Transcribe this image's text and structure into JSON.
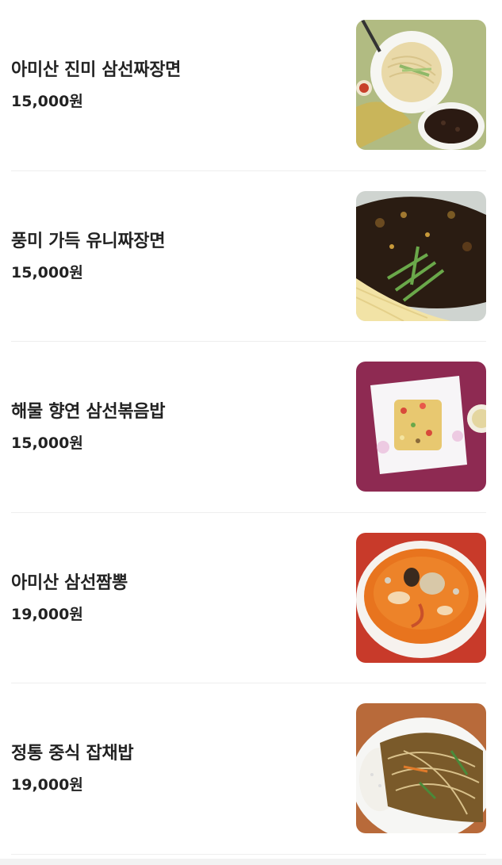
{
  "menu": {
    "items": [
      {
        "name": "아미산 진미 삼선짜장면",
        "price": "15,000원",
        "image": "jjajang-noodles-side-sauce-photo"
      },
      {
        "name": "풍미 가득 유니짜장면",
        "price": "15,000원",
        "image": "uni-jjajang-noodles-photo"
      },
      {
        "name": "해물 향연 삼선볶음밥",
        "price": "15,000원",
        "image": "seafood-fried-rice-photo"
      },
      {
        "name": "아미산 삼선짬뽕",
        "price": "19,000원",
        "image": "samseon-jjamppong-photo"
      },
      {
        "name": "정통 중식 잡채밥",
        "price": "19,000원",
        "image": "japchae-rice-photo"
      }
    ]
  },
  "colors": {
    "text": "#222222",
    "divider": "#eeeeee",
    "background": "#ffffff"
  }
}
